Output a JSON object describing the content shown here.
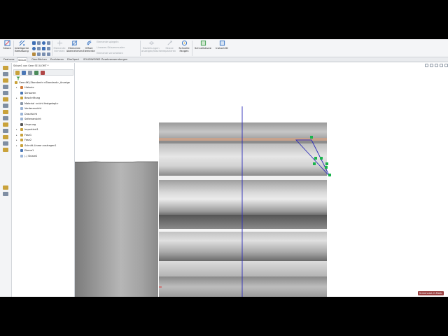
{
  "colors": {
    "ribbon_bg": "#f4f5f7",
    "sketch_line": "#2c2cb8",
    "sketch_point": "#19b44c",
    "tree_icon_yellow": "#e2b52a"
  },
  "ribbon": {
    "skizze": "Skizze",
    "intelligente_bemassung": "Intelligente Bemaßung",
    "elemente_trimmen": "Elemente trimmen",
    "elemente_uebernehmen": "Elemente übernehmen",
    "offset_elemente": "Offset Elemente",
    "elemente_spiegeln": "Elemente spiegeln",
    "lineares_skizzenmuster": "Lineares Skizzenmuster",
    "elemente_verschieben": "Elemente verschieben",
    "beziehungen": "Beziehungen anzeigen/löschen",
    "skizze_reparieren": "Skizze reparieren",
    "schnelle_fangen": "Schnelle Fangen",
    "schnellskizze": "Schnellskizze",
    "instant2d": "Instant2D"
  },
  "tabs": [
    "Features",
    "Skizze",
    "Oberflächen",
    "Evaluieren",
    "DimXpert",
    "SOLIDWORKS Zusatzanwendungen"
  ],
  "active_tab": "Skizze",
  "feature_manager": {
    "title": "Skizze1 von Gear SE-5LOMT *",
    "root": "Gear-6K (Standard<<Standard>_Anzeige",
    "items": [
      {
        "label": "Historie",
        "expand": "▸"
      },
      {
        "label": "Sensoren",
        "expand": ""
      },
      {
        "label": "Beschriftung",
        "expand": "▸"
      },
      {
        "label": "Material <nicht festgelegt>",
        "expand": ""
      },
      {
        "label": "Vorderansicht",
        "expand": ""
      },
      {
        "label": "Draufsicht",
        "expand": ""
      },
      {
        "label": "Seitenansicht",
        "expand": ""
      },
      {
        "label": "Ursprung",
        "expand": ""
      },
      {
        "label": "Importiert1",
        "expand": "▸"
      },
      {
        "label": "Fase1",
        "expand": "▸"
      },
      {
        "label": "Fase2",
        "expand": "▸"
      },
      {
        "label": "Schnitt-Linear austragen1",
        "expand": "▸"
      },
      {
        "label": "Ebene1",
        "expand": ""
      },
      {
        "label": "(-) Skizze2",
        "expand": ""
      }
    ]
  },
  "watermark": "Screencast-O-Matic"
}
